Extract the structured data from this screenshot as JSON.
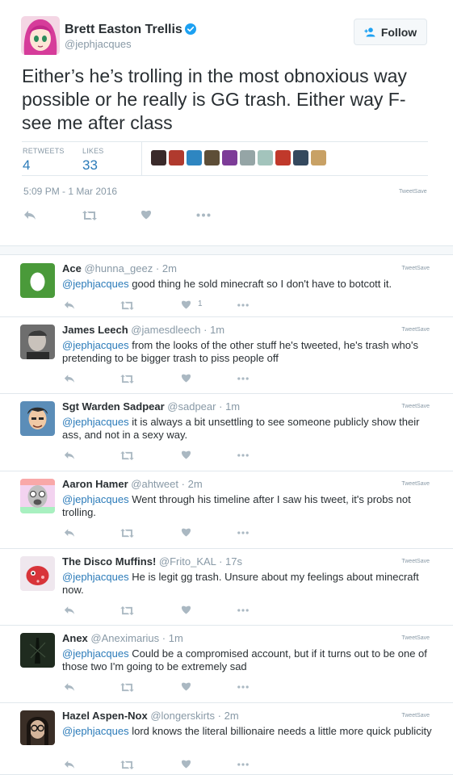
{
  "main_tweet": {
    "author": {
      "name": "Brett Easton Trellis",
      "handle": "@jephjacques",
      "verified": true
    },
    "follow_label": "Follow",
    "text": "Either’s he’s trolling in the most obnoxious way possible or he really is GG trash. Either way F- see me after class",
    "retweets_label": "RETWEETS",
    "retweets": "4",
    "likes_label": "LIKES",
    "likes": "33",
    "liker_colors": [
      "#3a2a2a",
      "#b03a2e",
      "#2e86c1",
      "#5d4e37",
      "#7d3c98",
      "#95a5a6",
      "#a3c4bc",
      "#c0392b",
      "#34495e",
      "#c8a165"
    ],
    "timestamp": "5:09 PM - 1 Mar 2016",
    "tweetsave": "TweetSave",
    "icons": [
      "reply-icon",
      "retweet-icon",
      "like-icon",
      "more-icon"
    ]
  },
  "colors": {
    "link": "#2b7bb9",
    "muted": "#8899a6",
    "text": "#292f33",
    "border": "#e1e8ed",
    "verified": "#1da1f2"
  },
  "replies": [
    {
      "name": "Ace",
      "handle": "@hunna_geez",
      "dot": "·",
      "time": "2m",
      "mention": "@jephjacques",
      "text": "good thing he sold minecraft so I don't have to botcott it.",
      "like_count": "1",
      "tweetsave": "TweetSave",
      "avatar": "egg"
    },
    {
      "name": "James Leech",
      "handle": "@jamesdleech",
      "dot": "·",
      "time": "1m",
      "mention": "@jephjacques",
      "text": "from the looks of the other stuff he's tweeted, he's trash who's pretending to be bigger trash to piss people off",
      "like_count": "",
      "tweetsave": "TweetSave",
      "avatar": "photo-gray"
    },
    {
      "name": "Sgt Warden Sadpear",
      "handle": "@sadpear",
      "dot": "·",
      "time": "1m",
      "mention": "@jephjacques",
      "text": "it is always a bit unsettling to see someone publicly show their ass, and not in a sexy way.",
      "like_count": "",
      "tweetsave": "TweetSave",
      "avatar": "cartoon-man"
    },
    {
      "name": "Aaron Hamer",
      "handle": "@ahtweet",
      "dot": "·",
      "time": "2m",
      "mention": "@jephjacques",
      "text": "Went through his timeline after I saw his tweet, it's probs not trolling.",
      "like_count": "",
      "tweetsave": "TweetSave",
      "avatar": "rainbow-face"
    },
    {
      "name": "The Disco Muffins!",
      "handle": "@Frito_KAL",
      "dot": "·",
      "time": "17s",
      "mention": "@jephjacques",
      "text": "He is legit gg trash. Unsure about my feelings about minecraft now.",
      "like_count": "",
      "tweetsave": "TweetSave",
      "avatar": "red-creature"
    },
    {
      "name": "Anex",
      "handle": "@Aneximarius",
      "dot": "·",
      "time": "1m",
      "mention": "@jephjacques",
      "text": "Could be a compromised account, but if it turns out to be one of those two I'm going to be extremely sad",
      "like_count": "",
      "tweetsave": "TweetSave",
      "avatar": "dark-figure"
    },
    {
      "name": "Hazel Aspen-Nox",
      "handle": "@longerskirts",
      "dot": "·",
      "time": "2m",
      "mention": "@jephjacques",
      "text": "lord knows the literal billionaire needs a little more quick publicity",
      "like_count": "",
      "tweetsave": "TweetSave",
      "avatar": "photo-glasses"
    }
  ]
}
